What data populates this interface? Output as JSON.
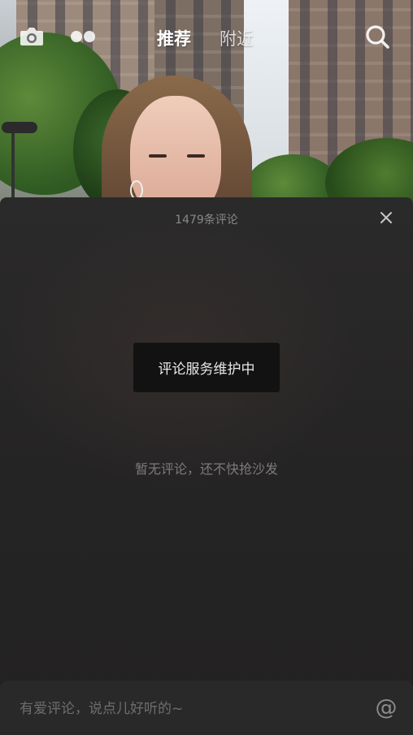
{
  "header": {
    "tabs": [
      {
        "label": "推荐",
        "active": true
      },
      {
        "label": "附近",
        "active": false
      }
    ],
    "icons": {
      "camera": "camera-icon",
      "dots": "flickr-dots-icon",
      "search": "search-icon"
    }
  },
  "comments": {
    "count_label": "1479条评论",
    "toast": "评论服务维护中",
    "empty_text": "暂无评论，还不快抢沙发",
    "input_placeholder": "有爱评论，说点儿好听的~",
    "at_symbol": "@",
    "close_icon": "close-icon"
  },
  "colors": {
    "panel_bg": "#252424",
    "toast_bg": "#121212",
    "muted_text": "#7d7b7a"
  }
}
